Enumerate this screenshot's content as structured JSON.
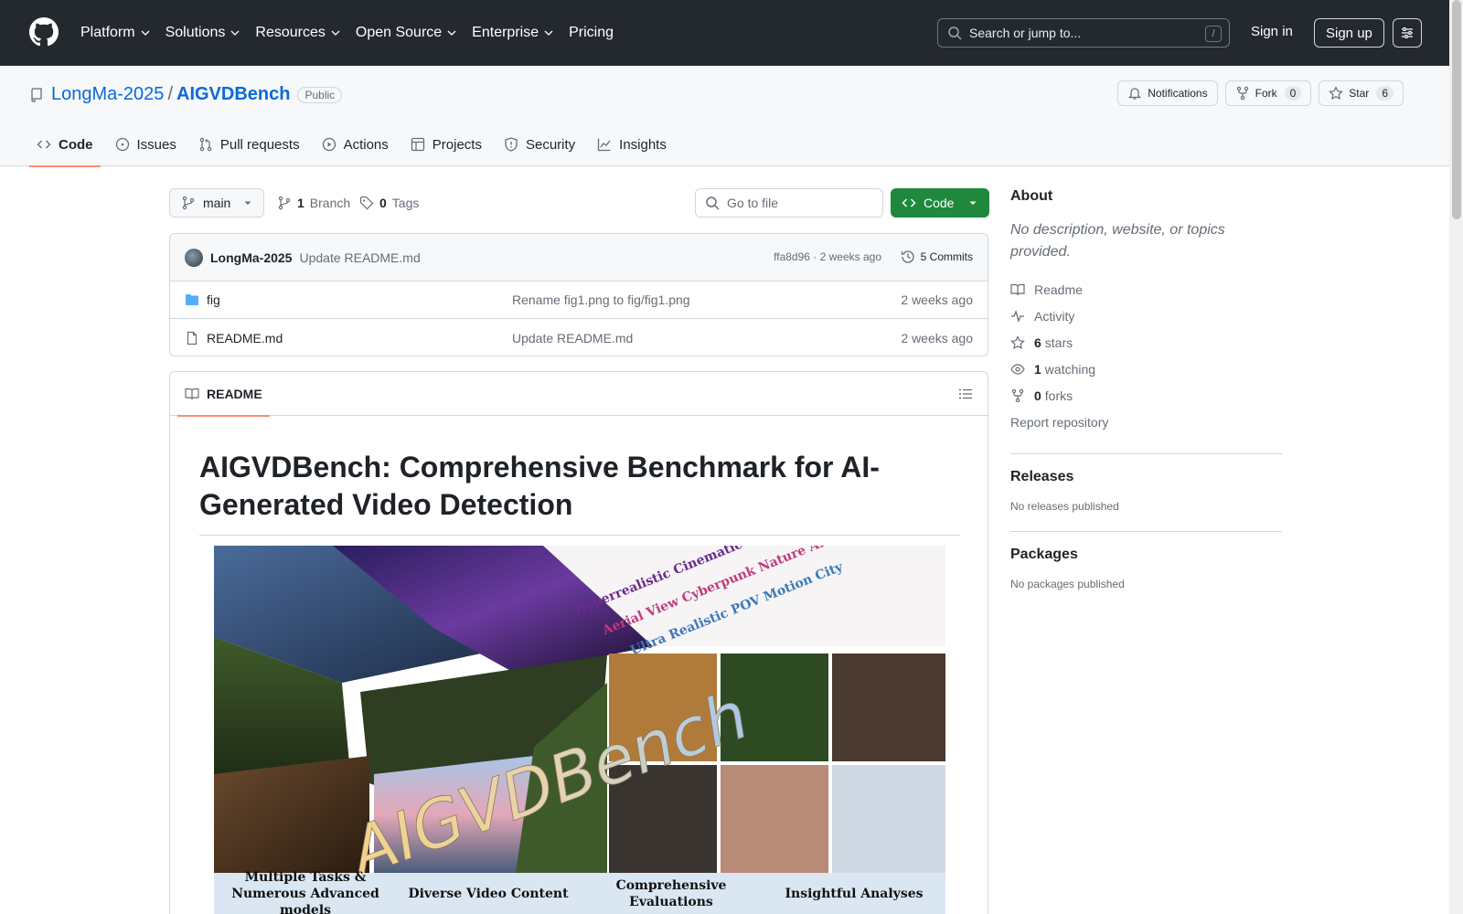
{
  "topnav": {
    "items": [
      "Platform",
      "Solutions",
      "Resources",
      "Open Source",
      "Enterprise",
      "Pricing"
    ],
    "search_placeholder": "Search or jump to...",
    "search_shortcut": "/",
    "signin": "Sign in",
    "signup": "Sign up"
  },
  "repo": {
    "owner": "LongMa-2025",
    "separator": "/",
    "name": "AIGVDBench",
    "visibility": "Public",
    "notifications_label": "Notifications",
    "fork_label": "Fork",
    "fork_count": "0",
    "star_label": "Star",
    "star_count": "6",
    "tabs": [
      "Code",
      "Issues",
      "Pull requests",
      "Actions",
      "Projects",
      "Security",
      "Insights"
    ]
  },
  "branchbar": {
    "branch": "main",
    "branch_count": "1",
    "branch_label": "Branch",
    "tag_count": "0",
    "tag_label": "Tags",
    "goto_placeholder": "Go to file",
    "code_label": "Code"
  },
  "commit": {
    "author": "LongMa-2025",
    "message": "Update README.md",
    "meta": "ffa8d96 · 2 weeks ago",
    "commits": "5 Commits"
  },
  "files": [
    {
      "name": "fig",
      "type": "folder",
      "message": "Rename fig1.png to fig/fig1.png",
      "time": "2 weeks ago"
    },
    {
      "name": "README.md",
      "type": "file",
      "message": "Update README.md",
      "time": "2 weeks ago"
    }
  ],
  "readme": {
    "tab_label": "README",
    "title": "AIGVDBench: Comprehensive Benchmark for AI-Generated Video Detection",
    "hero_captions": [
      "Multiple Tasks & Numerous Advanced models",
      "Diverse Video Content",
      "Comprehensive Evaluations",
      "Insightful Analyses"
    ],
    "hero_wordmark": "AIGVDBench"
  },
  "sidebar": {
    "about_title": "About",
    "about_desc": "No description, website, or topics provided.",
    "readme_link": "Readme",
    "activity_link": "Activity",
    "stars_count": "6",
    "stars_label": "stars",
    "watching_count": "1",
    "watching_label": "watching",
    "forks_count": "0",
    "forks_label": "forks",
    "report": "Report repository",
    "releases_title": "Releases",
    "releases_empty": "No releases published",
    "packages_title": "Packages",
    "packages_empty": "No packages published"
  },
  "colors": {
    "header_bg": "#24292f",
    "link": "#0969da",
    "primary_button": "#1f883d",
    "tab_underline": "#fd8c73"
  }
}
